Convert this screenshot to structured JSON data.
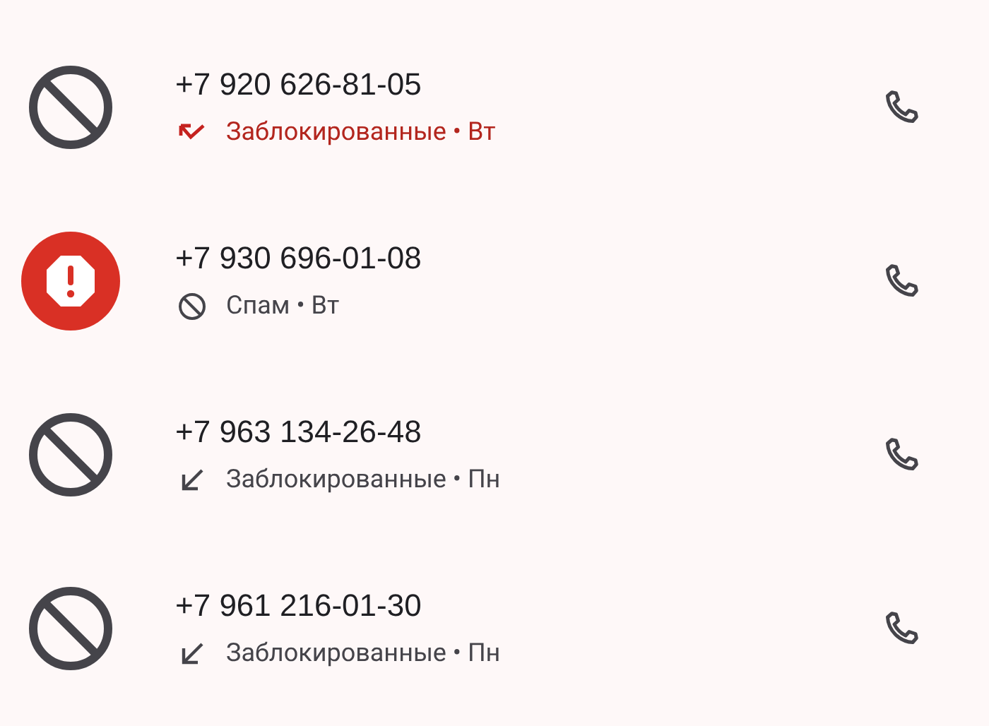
{
  "calls": [
    {
      "number": "+7 920 626-81-05",
      "avatar": {
        "kind": "blocked"
      },
      "call_icon": {
        "kind": "missed"
      },
      "detail": "Заблокированные • Вт"
    },
    {
      "number": "+7 930 696-01-08",
      "avatar": {
        "kind": "spam"
      },
      "call_icon": {
        "kind": "spam"
      },
      "detail": "Спам • Вт"
    },
    {
      "number": "+7 963 134-26-48",
      "avatar": {
        "kind": "blocked"
      },
      "call_icon": {
        "kind": "incoming"
      },
      "detail": "Заблокированные • Пн"
    },
    {
      "number": "+7 961 216-01-30",
      "avatar": {
        "kind": "blocked"
      },
      "call_icon": {
        "kind": "incoming"
      },
      "detail": "Заблокированные • Пн"
    }
  ]
}
